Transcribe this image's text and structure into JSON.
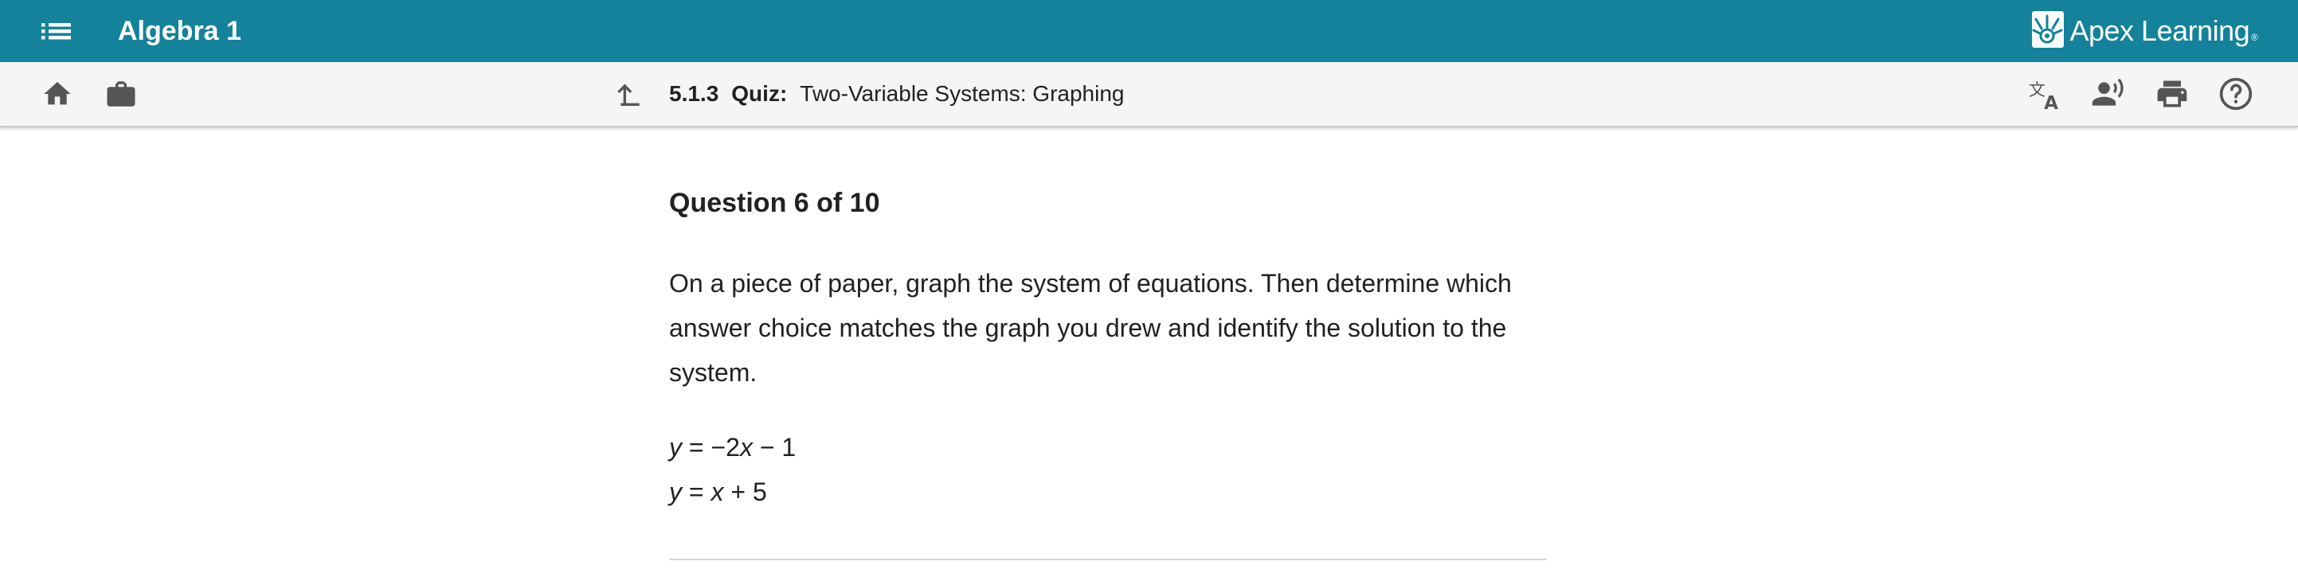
{
  "header": {
    "app_title": "Algebra 1",
    "brand_name": "Apex Learning",
    "brand_mark": "®",
    "background_color": "#13829a"
  },
  "toolbar": {
    "left_icons": [
      "home-icon",
      "briefcase-icon"
    ],
    "breadcrumb": {
      "number": "5.1.3",
      "kind": "Quiz:",
      "title": "Two-Variable Systems: Graphing"
    },
    "right_icons": [
      "translate-icon",
      "text-to-speech-icon",
      "print-icon",
      "help-icon"
    ]
  },
  "question": {
    "heading": "Question 6 of 10",
    "prompt": "On a piece of paper, graph the system of equations. Then determine which answer choice matches the graph you drew and identify the solution to the system.",
    "equations": [
      {
        "lhs": "y",
        "eq": " = −2",
        "var": "x",
        "rest": " − 1"
      },
      {
        "lhs": "y",
        "eq": " = ",
        "var": "x",
        "rest": " + 5"
      }
    ]
  }
}
